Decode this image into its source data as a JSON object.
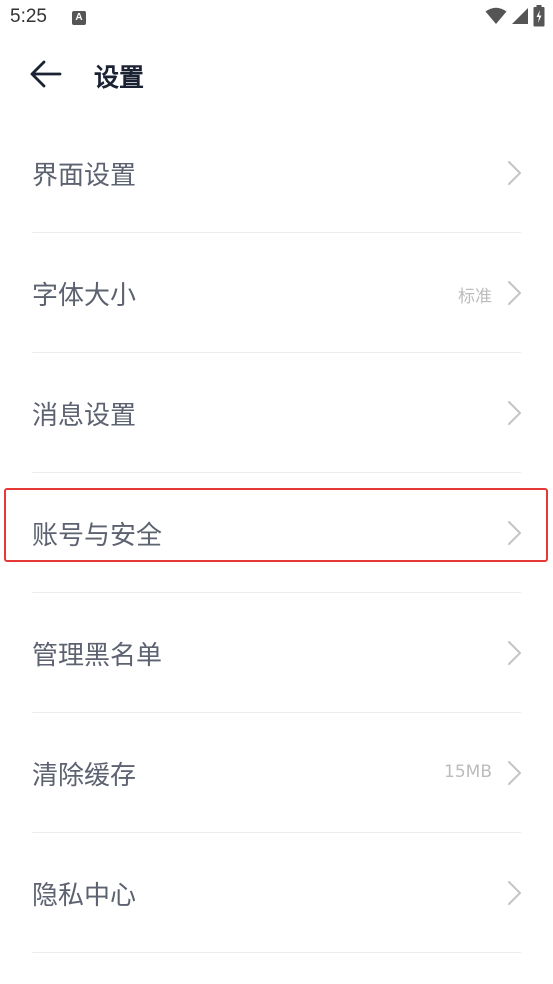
{
  "status_bar": {
    "time": "5:25",
    "notification_icon": "a-notification-icon",
    "notification_letter": "A",
    "icons": [
      "wifi-icon",
      "cellular-signal-icon",
      "battery-charging-icon"
    ]
  },
  "header": {
    "back_icon": "arrow-left-icon",
    "title": "设置"
  },
  "settings": {
    "items": [
      {
        "label": "界面设置",
        "value": ""
      },
      {
        "label": "字体大小",
        "value": "标准"
      },
      {
        "label": "消息设置",
        "value": ""
      },
      {
        "label": "账号与安全",
        "value": ""
      },
      {
        "label": "管理黑名单",
        "value": ""
      },
      {
        "label": "清除缓存",
        "value": "15MB"
      },
      {
        "label": "隐私中心",
        "value": ""
      }
    ]
  },
  "colors": {
    "title": "#1a2233",
    "label": "#5d6270",
    "value": "#bcbcbc",
    "chevron": "#c4c4c4",
    "divider": "#ececec",
    "highlight": "#e53935"
  }
}
